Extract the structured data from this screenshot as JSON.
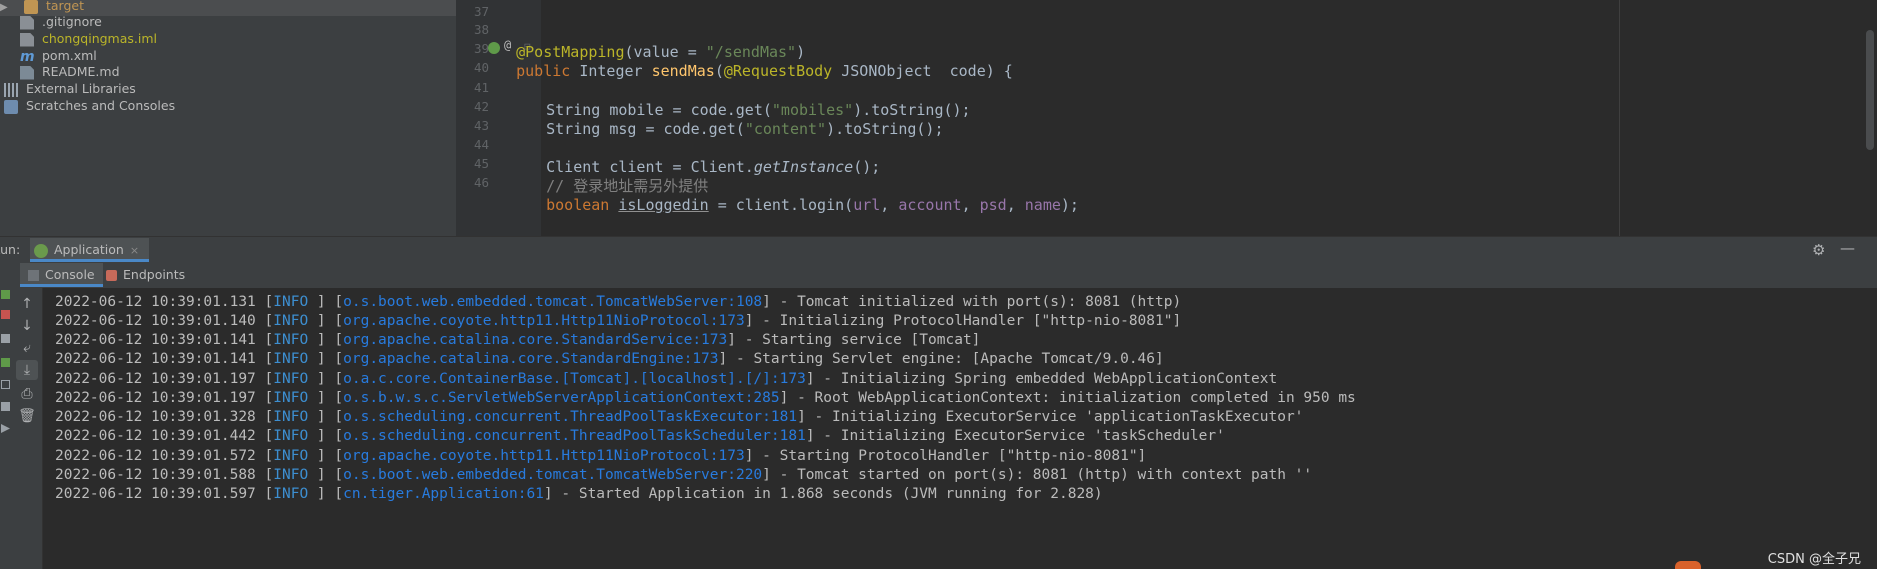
{
  "project_tree": {
    "items": [
      {
        "label": "target",
        "icon": "folder-icon",
        "color": "#c09553"
      },
      {
        "label": ".gitignore",
        "icon": "file-icon",
        "color": "#bbbbbb"
      },
      {
        "label": "chongqingmas.iml",
        "icon": "iml-file-icon",
        "color": "#bbb529"
      },
      {
        "label": "pom.xml",
        "icon": "maven-icon",
        "color": "#bbbbbb"
      },
      {
        "label": "README.md",
        "icon": "markdown-icon",
        "color": "#bbbbbb"
      },
      {
        "label": "External Libraries",
        "icon": "library-icon",
        "color": "#bbbbbb"
      },
      {
        "label": "Scratches and Consoles",
        "icon": "scratches-icon",
        "color": "#bbbbbb"
      }
    ]
  },
  "editor": {
    "line_numbers": [
      "37",
      "38",
      "39",
      "40",
      "41",
      "42",
      "43",
      "44",
      "45",
      "46"
    ],
    "lines": {
      "l38": {
        "annotation": "@PostMapping",
        "p1": "(",
        "param": "value",
        "eq": " = ",
        "str": "\"/sendMas\"",
        "p2": ")"
      },
      "l39": {
        "kw_public": "public",
        "type": " Integer ",
        "method": "sendMas",
        "p1": "(",
        "annotation": "@RequestBody",
        "rest": " JSONObject  code) {"
      },
      "l41": {
        "a": "String mobile = code.get(",
        "str": "\"mobiles\"",
        "b": ").toString();"
      },
      "l42": {
        "a": "String msg = code.get(",
        "str": "\"content\"",
        "b": ").toString();"
      },
      "l44": {
        "a": "Client client = Client.",
        "method": "getInstance",
        "b": "();"
      },
      "l45": {
        "comment": "// 登录地址需另外提供"
      },
      "l46": {
        "kw": "boolean",
        "sp": " ",
        "var": "isLoggedin",
        "a": " = client.login(",
        "f1": "url",
        "c1": ", ",
        "f2": "account",
        "c2": ", ",
        "f3": "psd",
        "c3": ", ",
        "f4": "name",
        "b": ");"
      }
    }
  },
  "run_panel": {
    "label": "Run:",
    "tab_label": "Application",
    "tab_close": "×",
    "subtabs": [
      {
        "label": "Console"
      },
      {
        "label": "Endpoints"
      }
    ],
    "log_lines": [
      {
        "ts": "2022-06-12 10:39:01.131",
        "level": "INFO ",
        "cls": "o.s.boot.web.embedded.tomcat.TomcatWebServer:108",
        "msg": "Tomcat initialized with port(s): 8081 (http)"
      },
      {
        "ts": "2022-06-12 10:39:01.140",
        "level": "INFO ",
        "cls": "org.apache.coyote.http11.Http11NioProtocol:173",
        "msg": "Initializing ProtocolHandler [\"http-nio-8081\"]"
      },
      {
        "ts": "2022-06-12 10:39:01.141",
        "level": "INFO ",
        "cls": "org.apache.catalina.core.StandardService:173",
        "msg": "Starting service [Tomcat]"
      },
      {
        "ts": "2022-06-12 10:39:01.141",
        "level": "INFO ",
        "cls": "org.apache.catalina.core.StandardEngine:173",
        "msg": "Starting Servlet engine: [Apache Tomcat/9.0.46]"
      },
      {
        "ts": "2022-06-12 10:39:01.197",
        "level": "INFO ",
        "cls": "o.a.c.core.ContainerBase.[Tomcat].[localhost].[/]:173",
        "msg": "Initializing Spring embedded WebApplicationContext"
      },
      {
        "ts": "2022-06-12 10:39:01.197",
        "level": "INFO ",
        "cls": "o.s.b.w.s.c.ServletWebServerApplicationContext:285",
        "msg": "Root WebApplicationContext: initialization completed in 950 ms"
      },
      {
        "ts": "2022-06-12 10:39:01.328",
        "level": "INFO ",
        "cls": "o.s.scheduling.concurrent.ThreadPoolTaskExecutor:181",
        "msg": "Initializing ExecutorService 'applicationTaskExecutor'"
      },
      {
        "ts": "2022-06-12 10:39:01.442",
        "level": "INFO ",
        "cls": "o.s.scheduling.concurrent.ThreadPoolTaskScheduler:181",
        "msg": "Initializing ExecutorService 'taskScheduler'"
      },
      {
        "ts": "2022-06-12 10:39:01.572",
        "level": "INFO ",
        "cls": "org.apache.coyote.http11.Http11NioProtocol:173",
        "msg": "Starting ProtocolHandler [\"http-nio-8081\"]"
      },
      {
        "ts": "2022-06-12 10:39:01.588",
        "level": "INFO ",
        "cls": "o.s.boot.web.embedded.tomcat.TomcatWebServer:220",
        "msg": "Tomcat started on port(s): 8081 (http) with context path ''"
      },
      {
        "ts": "2022-06-12 10:39:01.597",
        "level": "INFO ",
        "cls": "cn.tiger.Application:61",
        "msg": "Started Application in 1.868 seconds (JVM running for 2.828)"
      }
    ]
  },
  "watermark": "CSDN @全子兄"
}
